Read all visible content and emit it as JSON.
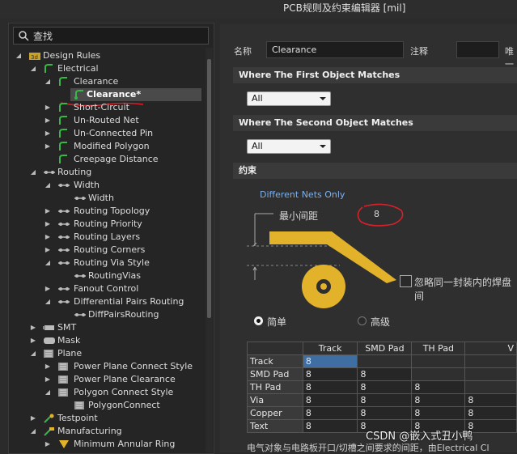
{
  "window_title": "PCB规则及约束编辑器 [mil]",
  "search": {
    "text": "查找"
  },
  "tree": [
    {
      "label": "Design Rules"
    },
    {
      "label": "Electrical"
    },
    {
      "label": "Clearance"
    },
    {
      "label": "Clearance*"
    },
    {
      "label": "Short-Circuit"
    },
    {
      "label": "Un-Routed Net"
    },
    {
      "label": "Un-Connected Pin"
    },
    {
      "label": "Modified Polygon"
    },
    {
      "label": "Creepage Distance"
    },
    {
      "label": "Routing"
    },
    {
      "label": "Width"
    },
    {
      "label": "Width"
    },
    {
      "label": "Routing Topology"
    },
    {
      "label": "Routing Priority"
    },
    {
      "label": "Routing Layers"
    },
    {
      "label": "Routing Corners"
    },
    {
      "label": "Routing Via Style"
    },
    {
      "label": "RoutingVias"
    },
    {
      "label": "Fanout Control"
    },
    {
      "label": "Differential Pairs Routing"
    },
    {
      "label": "DiffPairsRouting"
    },
    {
      "label": "SMT"
    },
    {
      "label": "Mask"
    },
    {
      "label": "Plane"
    },
    {
      "label": "Power Plane Connect Style"
    },
    {
      "label": "Power Plane Clearance"
    },
    {
      "label": "Polygon Connect Style"
    },
    {
      "label": "PolygonConnect"
    },
    {
      "label": "Testpoint"
    },
    {
      "label": "Manufacturing"
    },
    {
      "label": "Minimum Annular Ring"
    }
  ],
  "form": {
    "name_label": "名称",
    "name_value": "Clearance",
    "comment_label": "注释",
    "unique_label": "唯一"
  },
  "first_match": {
    "title": "Where The First Object Matches",
    "value": "All"
  },
  "second_match": {
    "title": "Where The Second Object Matches",
    "value": "All"
  },
  "constraints": {
    "title": "约束",
    "nets_mode": "Different Nets Only",
    "min_clearance_label": "最小间距",
    "min_clearance_value": "8",
    "ignore_pads_label": "忽略同一封装内的焊盘间",
    "mode_simple": "简单",
    "mode_advanced": "高级"
  },
  "table": {
    "columns": [
      "Track",
      "SMD Pad",
      "TH Pad",
      "V"
    ],
    "rows": [
      {
        "name": "Track",
        "values": [
          "8",
          "",
          "",
          ""
        ]
      },
      {
        "name": "SMD Pad",
        "values": [
          "8",
          "8",
          "",
          ""
        ]
      },
      {
        "name": "TH Pad",
        "values": [
          "8",
          "8",
          "8",
          ""
        ]
      },
      {
        "name": "Via",
        "values": [
          "8",
          "8",
          "8",
          "8"
        ]
      },
      {
        "name": "Copper",
        "values": [
          "8",
          "8",
          "8",
          "8"
        ]
      },
      {
        "name": "Text",
        "values": [
          "8",
          "8",
          "8",
          "8"
        ]
      }
    ]
  },
  "footer_text": "电气对象与电路板开口/切槽之间要求的间距，由Electrical Cl",
  "watermark": "CSDN @嵌入式丑小鸭",
  "colors": {
    "accent": "#e2b22a",
    "highlight": "#3f6ea3",
    "annotation": "#d9202a"
  }
}
